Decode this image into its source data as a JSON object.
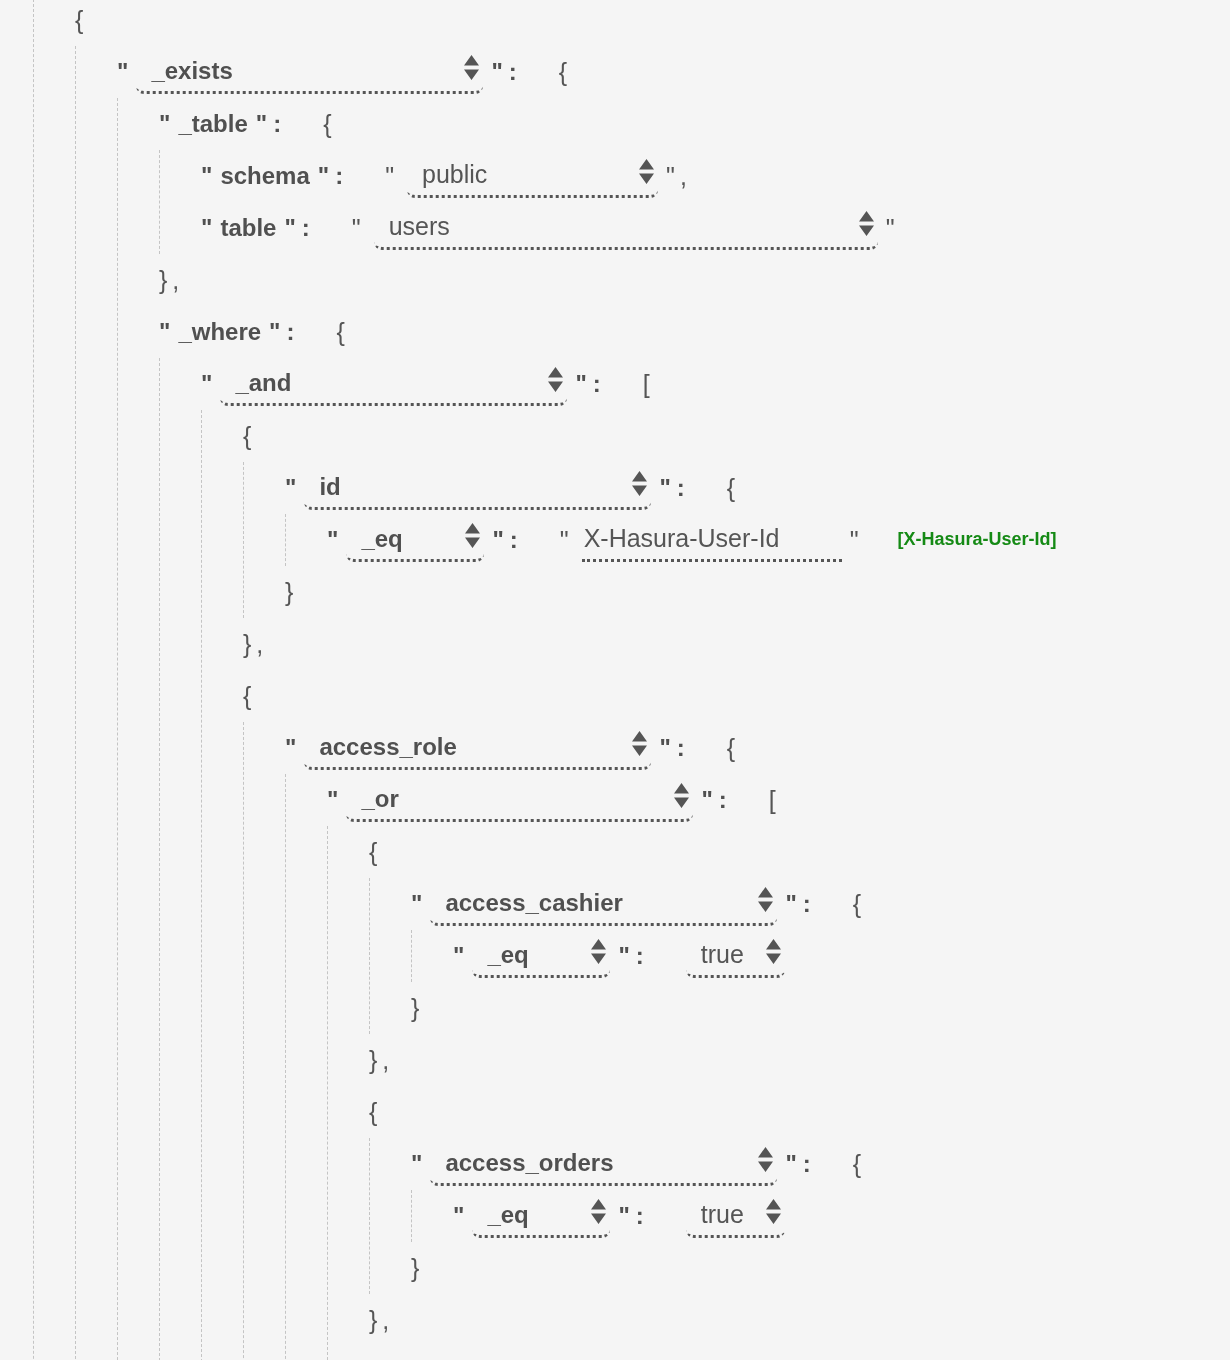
{
  "tree": {
    "line": [
      {
        "kind": "bracket",
        "text": "{"
      }
    ],
    "children": [
      {
        "line": [
          {
            "kind": "keystart",
            "text": "\""
          },
          {
            "kind": "fieldselect",
            "text": "_exists"
          },
          {
            "kind": "keyend",
            "text": "\":"
          },
          {
            "kind": "bracket",
            "text": "{"
          }
        ],
        "children": [
          {
            "line": [
              {
                "kind": "keystart",
                "text": "\""
              },
              {
                "kind": "key",
                "text": "_table"
              },
              {
                "kind": "keyend",
                "text": "\":"
              },
              {
                "kind": "bracket",
                "text": "{"
              }
            ],
            "children": [
              {
                "line": [
                  {
                    "kind": "keystart",
                    "text": "\""
                  },
                  {
                    "kind": "key",
                    "text": "schema"
                  },
                  {
                    "kind": "keyend",
                    "text": "\":"
                  },
                  {
                    "kind": "quote",
                    "text": "\""
                  },
                  {
                    "kind": "schemaselect",
                    "text": "public"
                  },
                  {
                    "kind": "quote",
                    "text": "\","
                  }
                ]
              },
              {
                "line": [
                  {
                    "kind": "keystart",
                    "text": "\""
                  },
                  {
                    "kind": "key",
                    "text": "table"
                  },
                  {
                    "kind": "keyend",
                    "text": "\":"
                  },
                  {
                    "kind": "quote",
                    "text": "\""
                  },
                  {
                    "kind": "tableselect",
                    "text": "users"
                  },
                  {
                    "kind": "quote",
                    "text": "\""
                  }
                ]
              }
            ],
            "close": "},"
          },
          {
            "line": [
              {
                "kind": "keystart",
                "text": "\""
              },
              {
                "kind": "key",
                "text": "_where"
              },
              {
                "kind": "keyend",
                "text": "\":"
              },
              {
                "kind": "bracket",
                "text": "{"
              }
            ],
            "children": [
              {
                "line": [
                  {
                    "kind": "keystart",
                    "text": "\""
                  },
                  {
                    "kind": "fieldselect",
                    "text": "_and"
                  },
                  {
                    "kind": "keyend",
                    "text": "\":"
                  },
                  {
                    "kind": "bracket",
                    "text": "["
                  }
                ],
                "children": [
                  {
                    "line": [
                      {
                        "kind": "bracket",
                        "text": "{"
                      }
                    ],
                    "children": [
                      {
                        "line": [
                          {
                            "kind": "keystart",
                            "text": "\""
                          },
                          {
                            "kind": "fieldselect",
                            "text": "id"
                          },
                          {
                            "kind": "keyend",
                            "text": "\":"
                          },
                          {
                            "kind": "bracket",
                            "text": "{"
                          }
                        ],
                        "children": [
                          {
                            "line": [
                              {
                                "kind": "keystart",
                                "text": "\""
                              },
                              {
                                "kind": "opselect",
                                "text": "_eq"
                              },
                              {
                                "kind": "keyend",
                                "text": "\":"
                              },
                              {
                                "kind": "quote",
                                "text": "\""
                              },
                              {
                                "kind": "sessioninput",
                                "text": "X-Hasura-User-Id"
                              },
                              {
                                "kind": "quote",
                                "text": "\""
                              },
                              {
                                "kind": "hint",
                                "text": "[X-Hasura-User-Id]"
                              }
                            ]
                          }
                        ],
                        "close": "}"
                      }
                    ],
                    "close": "},"
                  },
                  {
                    "line": [
                      {
                        "kind": "bracket",
                        "text": "{"
                      }
                    ],
                    "children": [
                      {
                        "line": [
                          {
                            "kind": "keystart",
                            "text": "\""
                          },
                          {
                            "kind": "fieldselect",
                            "text": "access_role"
                          },
                          {
                            "kind": "keyend",
                            "text": "\":"
                          },
                          {
                            "kind": "bracket",
                            "text": "{"
                          }
                        ],
                        "children": [
                          {
                            "line": [
                              {
                                "kind": "keystart",
                                "text": "\""
                              },
                              {
                                "kind": "fieldselect",
                                "text": "_or"
                              },
                              {
                                "kind": "keyend",
                                "text": "\":"
                              },
                              {
                                "kind": "bracket",
                                "text": "["
                              }
                            ],
                            "children": [
                              {
                                "line": [
                                  {
                                    "kind": "bracket",
                                    "text": "{"
                                  }
                                ],
                                "children": [
                                  {
                                    "line": [
                                      {
                                        "kind": "keystart",
                                        "text": "\""
                                      },
                                      {
                                        "kind": "fieldselect",
                                        "text": "access_cashier"
                                      },
                                      {
                                        "kind": "keyend",
                                        "text": "\":"
                                      },
                                      {
                                        "kind": "bracket",
                                        "text": "{"
                                      }
                                    ],
                                    "children": [
                                      {
                                        "line": [
                                          {
                                            "kind": "keystart",
                                            "text": "\""
                                          },
                                          {
                                            "kind": "opselect",
                                            "text": "_eq"
                                          },
                                          {
                                            "kind": "keyend",
                                            "text": "\":"
                                          },
                                          {
                                            "kind": "boolselect",
                                            "text": "true"
                                          }
                                        ]
                                      }
                                    ],
                                    "close": "}"
                                  }
                                ],
                                "close": "},"
                              },
                              {
                                "line": [
                                  {
                                    "kind": "bracket",
                                    "text": "{"
                                  }
                                ],
                                "children": [
                                  {
                                    "line": [
                                      {
                                        "kind": "keystart",
                                        "text": "\""
                                      },
                                      {
                                        "kind": "fieldselect",
                                        "text": "access_orders"
                                      },
                                      {
                                        "kind": "keyend",
                                        "text": "\":"
                                      },
                                      {
                                        "kind": "bracket",
                                        "text": "{"
                                      }
                                    ],
                                    "children": [
                                      {
                                        "line": [
                                          {
                                            "kind": "keystart",
                                            "text": "\""
                                          },
                                          {
                                            "kind": "opselect",
                                            "text": "_eq"
                                          },
                                          {
                                            "kind": "keyend",
                                            "text": "\":"
                                          },
                                          {
                                            "kind": "boolselect",
                                            "text": "true"
                                          }
                                        ]
                                      }
                                    ],
                                    "close": "}"
                                  }
                                ],
                                "close": "},"
                              }
                            ]
                          }
                        ]
                      }
                    ]
                  }
                ]
              }
            ]
          }
        ]
      }
    ]
  }
}
